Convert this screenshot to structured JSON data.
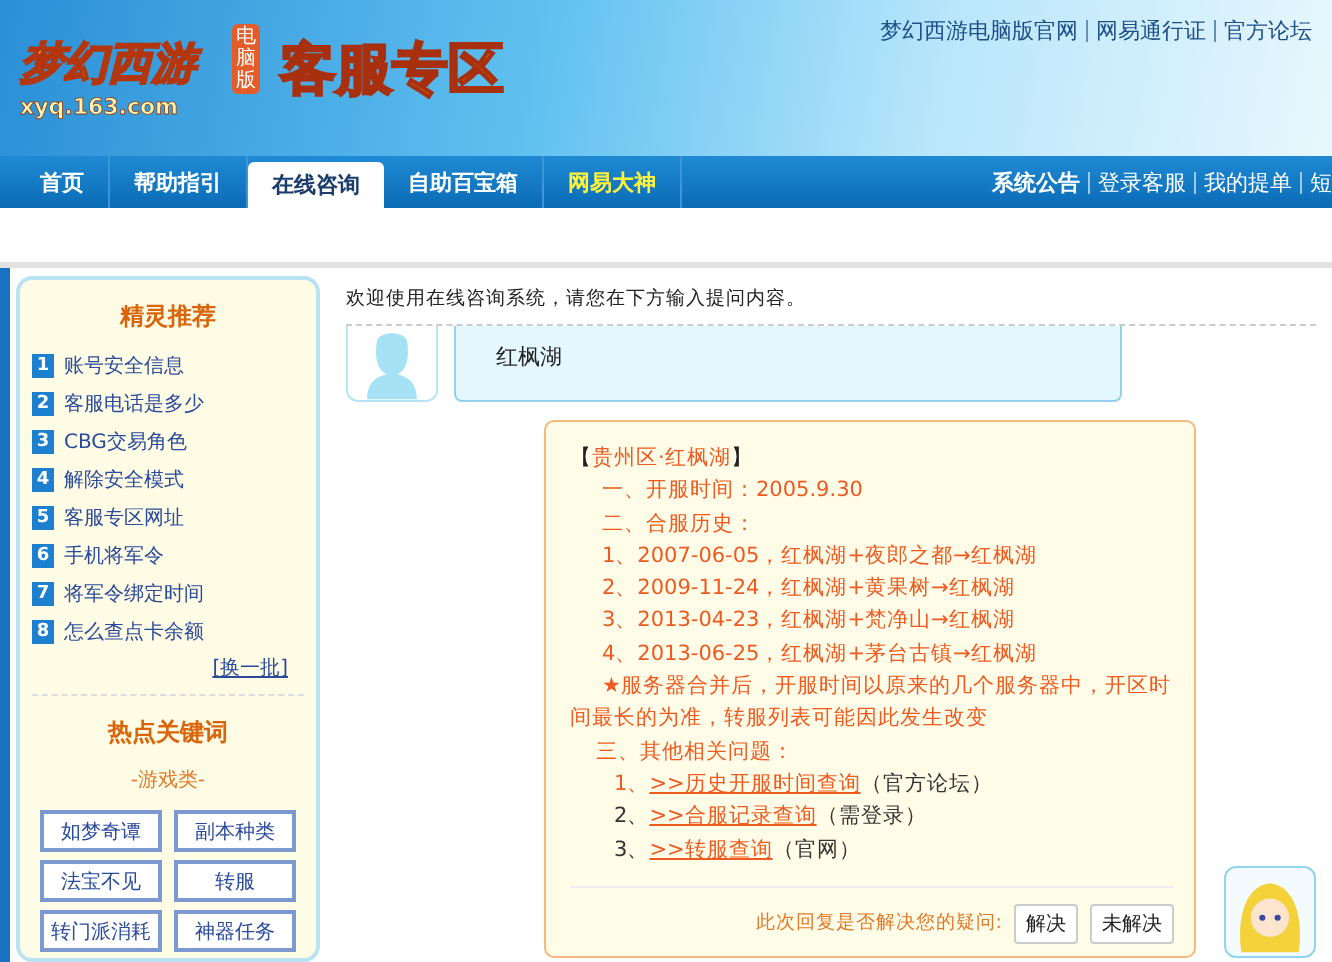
{
  "header": {
    "logo": {
      "name": "梦幻西游",
      "edition": "电脑版",
      "domain": "xyq.163.com"
    },
    "title": "客服专区",
    "links": [
      "梦幻西游电脑版官网",
      "网易通行证",
      "官方论坛"
    ]
  },
  "nav": {
    "tabs": [
      {
        "label": "首页",
        "selected": false,
        "highlight": false
      },
      {
        "label": "帮助指引",
        "selected": false,
        "highlight": false
      },
      {
        "label": "在线咨询",
        "selected": true,
        "highlight": false
      },
      {
        "label": "自助百宝箱",
        "selected": false,
        "highlight": false
      },
      {
        "label": "网易大神",
        "selected": false,
        "highlight": true
      }
    ],
    "links": [
      {
        "label": "系统公告",
        "bold": true
      },
      {
        "label": "登录客服",
        "bold": false
      },
      {
        "label": "我的提单",
        "bold": false
      },
      {
        "label": "短",
        "bold": false
      }
    ]
  },
  "sidebar": {
    "recommend": {
      "title": "精灵推荐",
      "items": [
        {
          "num": "1",
          "label": "账号安全信息"
        },
        {
          "num": "2",
          "label": "客服电话是多少"
        },
        {
          "num": "3",
          "label": "CBG交易角色"
        },
        {
          "num": "4",
          "label": "解除安全模式"
        },
        {
          "num": "5",
          "label": "客服专区网址"
        },
        {
          "num": "6",
          "label": "手机将军令"
        },
        {
          "num": "7",
          "label": "将军令绑定时间"
        },
        {
          "num": "8",
          "label": "怎么查点卡余额"
        }
      ],
      "refresh": "[换一批]"
    },
    "hot": {
      "title": "热点关键词",
      "category": "-游戏类-",
      "keywords": [
        "如梦奇谭",
        "副本种类",
        "法宝不见",
        "转服",
        "转门派消耗",
        "神器任务"
      ]
    }
  },
  "chat": {
    "welcome": "欢迎使用在线咨询系统，请您在下方输入提问内容。",
    "user_message": "红枫湖",
    "reply": {
      "lines": [
        {
          "kind": "heading",
          "text": "【贵州区·红枫湖】"
        },
        {
          "kind": "indent",
          "text": "一、开服时间：2005.9.30"
        },
        {
          "kind": "indent",
          "text": "二、合服历史："
        },
        {
          "kind": "indent",
          "text": "1、2007-06-05，红枫湖+夜郎之都→红枫湖"
        },
        {
          "kind": "indent",
          "text": "2、2009-11-24，红枫湖+黄果树→红枫湖"
        },
        {
          "kind": "indent",
          "text": "3、2013-04-23，红枫湖+梵净山→红枫湖"
        },
        {
          "kind": "indent",
          "text": "4、2013-06-25，红枫湖+茅台古镇→红枫湖"
        },
        {
          "kind": "note",
          "text": "★服务器合并后，开服时间以原来的几个服务器中，开区时间最长的为准，转服列表可能因此发生改变"
        },
        {
          "kind": "sub",
          "text": "三、其他相关问题："
        }
      ],
      "links": [
        {
          "num": "1、",
          "link": ">>历史开服时间查询",
          "note": "（官方论坛）",
          "highlight": true
        },
        {
          "num": "2、",
          "link": ">>合服记录查询",
          "note": "（需登录）",
          "highlight": false
        },
        {
          "num": "3、",
          "link": ">>转服查询",
          "note": "（官网）",
          "highlight": false
        }
      ],
      "feedback": {
        "question": "此次回复是否解决您的疑问:",
        "buttons": [
          "解决",
          "未解决"
        ]
      }
    }
  }
}
